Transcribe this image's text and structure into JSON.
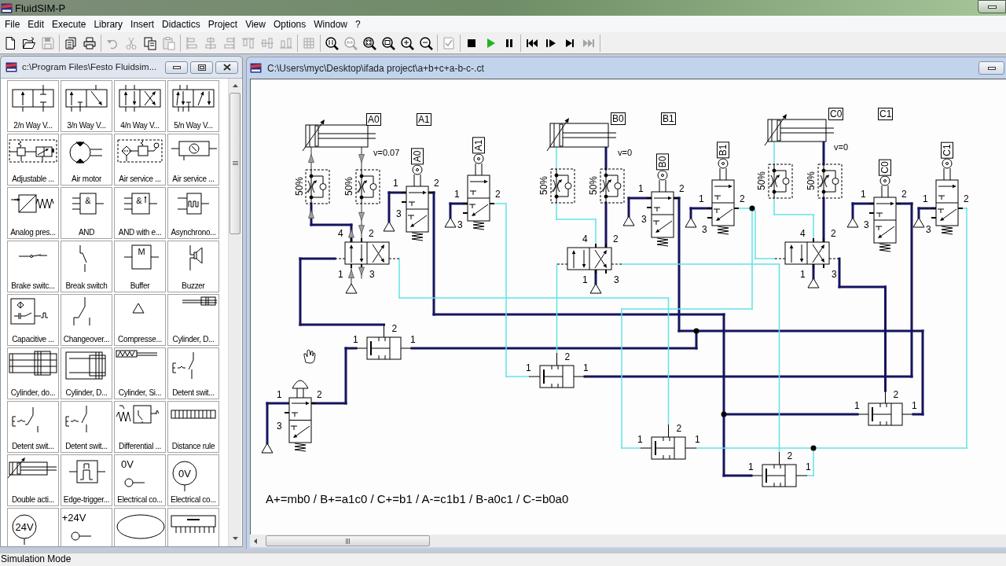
{
  "window": {
    "title": "FluidSIM-P"
  },
  "menu": [
    "File",
    "Edit",
    "Execute",
    "Library",
    "Insert",
    "Didactics",
    "Project",
    "View",
    "Options",
    "Window",
    "?"
  ],
  "toolbar_groups": [
    [
      {
        "kind": "new",
        "disabled": false
      },
      {
        "kind": "open",
        "disabled": false
      },
      {
        "kind": "save",
        "disabled": true
      }
    ],
    [
      {
        "kind": "print_preview",
        "disabled": false
      },
      {
        "kind": "print",
        "disabled": false
      }
    ],
    [
      {
        "kind": "undo",
        "disabled": true
      },
      {
        "kind": "cut",
        "disabled": true
      },
      {
        "kind": "copy",
        "disabled": false
      },
      {
        "kind": "paste",
        "disabled": true
      }
    ],
    [
      {
        "kind": "align_left",
        "disabled": true
      },
      {
        "kind": "align_center",
        "disabled": true
      },
      {
        "kind": "align_right",
        "disabled": true
      },
      {
        "kind": "align_top",
        "disabled": true
      },
      {
        "kind": "align_middle",
        "disabled": true
      },
      {
        "kind": "align_bottom",
        "disabled": true
      }
    ],
    [
      {
        "kind": "grid",
        "disabled": true
      }
    ],
    [
      {
        "kind": "zoom_actual",
        "disabled": false
      },
      {
        "kind": "zoom_previous",
        "disabled": true
      },
      {
        "kind": "zoom_fit",
        "disabled": false
      },
      {
        "kind": "zoom_window",
        "disabled": false
      },
      {
        "kind": "zoom_in",
        "disabled": false
      },
      {
        "kind": "zoom_out",
        "disabled": false
      }
    ],
    [
      {
        "kind": "check",
        "disabled": true
      }
    ],
    [
      {
        "kind": "stop",
        "disabled": false
      },
      {
        "kind": "start",
        "disabled": false
      },
      {
        "kind": "pause",
        "disabled": false
      }
    ],
    [
      {
        "kind": "reset",
        "disabled": false
      },
      {
        "kind": "step",
        "disabled": false
      },
      {
        "kind": "run_to",
        "disabled": false
      },
      {
        "kind": "fast_forward",
        "disabled": true
      }
    ]
  ],
  "library": {
    "title": "c:\\Program Files\\Festo Fluidsim...",
    "items": [
      {
        "kind": "valve_2n",
        "label": "2/n Way V..."
      },
      {
        "kind": "valve_3n",
        "label": "3/n Way V..."
      },
      {
        "kind": "valve_4n",
        "label": "4/n Way V..."
      },
      {
        "kind": "valve_5n",
        "label": "5/n Way V..."
      },
      {
        "kind": "service_adjustable",
        "label": "Adjustable ..."
      },
      {
        "kind": "air_motor",
        "label": "Air motor"
      },
      {
        "kind": "service_unit",
        "label": "Air service ..."
      },
      {
        "kind": "service_simple",
        "label": "Air service ..."
      },
      {
        "kind": "analog_converter",
        "label": "Analog pres..."
      },
      {
        "kind": "and_gate",
        "label": "AND",
        "symbol_text": "&"
      },
      {
        "kind": "and_edge",
        "label": "AND with e...",
        "symbol_text": "&"
      },
      {
        "kind": "async",
        "label": "Asynchrono..."
      },
      {
        "kind": "brake_switch",
        "label": "Brake switc..."
      },
      {
        "kind": "break_switch",
        "label": "Break switch"
      },
      {
        "kind": "buffer",
        "label": "Buffer",
        "symbol_text": "M"
      },
      {
        "kind": "buzzer",
        "label": "Buzzer"
      },
      {
        "kind": "capacitive",
        "label": "Capacitive ..."
      },
      {
        "kind": "changeover",
        "label": "Changeover..."
      },
      {
        "kind": "compressor",
        "label": "Compresse..."
      },
      {
        "kind": "cylinder_thin",
        "label": "Cylinder, D..."
      },
      {
        "kind": "cylinder_double",
        "label": "Cylinder, do..."
      },
      {
        "kind": "cylinder_d2",
        "label": "Cylinder, D..."
      },
      {
        "kind": "cylinder_spring",
        "label": "Cylinder, Si..."
      },
      {
        "kind": "detent_a",
        "label": "Detent swit..."
      },
      {
        "kind": "detent_b",
        "label": "Detent swit..."
      },
      {
        "kind": "detent_c",
        "label": "Detent swit..."
      },
      {
        "kind": "differential",
        "label": "Differential ..."
      },
      {
        "kind": "distance_rule",
        "label": "Distance rule"
      },
      {
        "kind": "double_acting",
        "label": "Double acti..."
      },
      {
        "kind": "edge_trigger",
        "label": "Edge-trigger..."
      },
      {
        "kind": "terminal",
        "label": "Electrical co...",
        "symbol_text": "0V"
      },
      {
        "kind": "ring_terminal",
        "label": "Electrical co...",
        "symbol_text": "0V"
      },
      {
        "kind": "ring_terminal",
        "symbol_text": "24V"
      },
      {
        "kind": "terminal",
        "symbol_text": "+24V"
      },
      {
        "kind": "ellipse"
      },
      {
        "kind": "chip"
      }
    ]
  },
  "diagram": {
    "title": "C:\\Users\\myc\\Desktop\\ifada project\\a+b+c+a-b-c-.ct",
    "cylinders": [
      {
        "sensor_tags": [
          "A0",
          "A1"
        ],
        "speed": "v=0.07",
        "throttle_settings": [
          "50%",
          "50%"
        ]
      },
      {
        "sensor_tags": [
          "B0",
          "B1"
        ],
        "speed": "v=0",
        "throttle_settings": [
          "50%",
          "50%"
        ]
      },
      {
        "sensor_tags": [
          "C0",
          "C1"
        ],
        "speed": "v=0",
        "throttle_settings": [
          "50%",
          "50%"
        ]
      }
    ],
    "directional_valves": [
      {
        "switched": true,
        "ports": [
          "4",
          "2",
          "1",
          "3"
        ]
      },
      {
        "switched": false,
        "ports": [
          "4",
          "2",
          "1",
          "3"
        ]
      },
      {
        "switched": false,
        "ports": [
          "4",
          "2",
          "1",
          "3"
        ]
      }
    ],
    "limit_valves": [
      {
        "label": "A0",
        "actuated": true,
        "ports": [
          "1",
          "2",
          "3"
        ]
      },
      {
        "label": "A1",
        "actuated": false,
        "ports": [
          "1",
          "2",
          "3"
        ]
      },
      {
        "label": "B0",
        "actuated": true,
        "ports": [
          "1",
          "2",
          "3"
        ]
      },
      {
        "label": "B1",
        "actuated": false,
        "ports": [
          "1",
          "2",
          "3"
        ]
      },
      {
        "label": "C0",
        "actuated": true,
        "ports": [
          "1",
          "2",
          "3"
        ]
      },
      {
        "label": "C1",
        "actuated": false,
        "ports": [
          "1",
          "2",
          "3"
        ]
      }
    ],
    "start_valve": {
      "pressed": true,
      "ports": [
        "1",
        "2",
        "3"
      ]
    },
    "and_valves": [
      {
        "ports": [
          "1",
          "1",
          "2"
        ]
      },
      {
        "ports": [
          "1",
          "1",
          "2"
        ]
      },
      {
        "ports": [
          "1",
          "1",
          "2"
        ]
      },
      {
        "ports": [
          "1",
          "1",
          "2"
        ]
      },
      {
        "ports": [
          "1",
          "1",
          "2"
        ]
      }
    ],
    "pipe_segments": [
      {
        "pressurized": true,
        "flowing": false
      },
      {
        "pressurized": true,
        "flowing": false
      },
      {
        "pressurized": true,
        "flowing": false
      },
      {
        "pressurized": true,
        "flowing": false
      },
      {
        "pressurized": true,
        "flowing": false
      },
      {
        "pressurized": true,
        "flowing": false
      },
      {
        "pressurized": true,
        "flowing": false
      },
      {
        "pressurized": true,
        "flowing": false
      },
      {
        "pressurized": true,
        "flowing": false
      },
      {
        "pressurized": true,
        "flowing": false
      },
      {
        "pressurized": true,
        "flowing": false
      },
      {
        "pressurized": true,
        "flowing": false
      },
      {
        "pressurized": true,
        "flowing": false
      },
      {
        "pressurized": true,
        "flowing": false
      },
      {
        "pressurized": true,
        "flowing": false
      },
      {
        "pressurized": true,
        "flowing": false
      },
      {
        "pressurized": true,
        "flowing": false
      },
      {
        "pressurized": true,
        "flowing": false
      },
      {
        "pressurized": true,
        "flowing": false
      },
      {
        "pressurized": true,
        "flowing": false
      },
      {
        "pressurized": true,
        "flowing": false
      },
      {
        "pressurized": true,
        "flowing": false
      },
      {
        "pressurized": true,
        "flowing": false
      },
      {
        "pressurized": true,
        "flowing": false
      },
      {
        "pressurized": true,
        "flowing": false
      },
      {
        "pressurized": true,
        "flowing": false
      },
      {
        "pressurized": true,
        "flowing": false
      },
      {
        "pressurized": true,
        "flowing": false
      },
      {
        "pressurized": true,
        "flowing": false
      },
      {
        "pressurized": true,
        "flowing": false
      },
      {
        "pressurized": true,
        "flowing": false
      },
      {
        "pressurized": true,
        "flowing": false
      },
      {
        "pressurized": true,
        "flowing": false
      },
      {
        "pressurized": true,
        "flowing": false
      },
      {
        "pressurized": true,
        "flowing": false
      },
      {
        "pressurized": true,
        "flowing": false
      },
      {
        "pressurized": true,
        "flowing": true
      },
      {
        "pressurized": true,
        "flowing": false
      },
      {
        "pressurized": true,
        "flowing": true
      },
      {
        "pressurized": true,
        "flowing": false
      },
      {
        "pressurized": true,
        "flowing": false
      },
      {
        "pressurized": true,
        "flowing": false
      },
      {
        "pressurized": true,
        "flowing": false
      },
      {
        "pressurized": true,
        "flowing": false
      },
      {
        "pressurized": true,
        "flowing": false
      },
      {
        "pressurized": true,
        "flowing": false
      },
      {
        "pressurized": true,
        "flowing": false
      },
      {
        "pressurized": true,
        "flowing": false
      },
      {
        "pressurized": false,
        "flowing": false
      },
      {
        "pressurized": false,
        "flowing": false
      },
      {
        "pressurized": false,
        "flowing": false
      },
      {
        "pressurized": false,
        "flowing": false
      },
      {
        "pressurized": false,
        "flowing": false
      },
      {
        "pressurized": false,
        "flowing": false
      },
      {
        "pressurized": false,
        "flowing": false
      },
      {
        "pressurized": false,
        "flowing": false
      },
      {
        "pressurized": false,
        "flowing": false
      },
      {
        "pressurized": false,
        "flowing": false
      },
      {
        "pressurized": false,
        "flowing": false
      },
      {
        "pressurized": false,
        "flowing": false
      },
      {
        "pressurized": false,
        "flowing": false
      },
      {
        "pressurized": false,
        "flowing": false
      },
      {
        "pressurized": false,
        "flowing": false
      },
      {
        "pressurized": false,
        "flowing": false
      },
      {
        "pressurized": false,
        "flowing": false
      },
      {
        "pressurized": false,
        "flowing": false
      },
      {
        "pressurized": false,
        "flowing": false
      },
      {
        "pressurized": false,
        "flowing": false
      },
      {
        "pressurized": false,
        "flowing": false
      },
      {
        "pressurized": false,
        "flowing": false
      },
      {
        "pressurized": false,
        "flowing": false
      },
      {
        "pressurized": false,
        "flowing": false
      },
      {
        "pressurized": false,
        "flowing": false
      },
      {
        "pressurized": false,
        "flowing": false
      },
      {
        "pressurized": false,
        "flowing": false
      },
      {
        "pressurized": false,
        "flowing": false
      },
      {
        "pressurized": false,
        "flowing": false
      },
      {
        "pressurized": false,
        "flowing": true
      },
      {
        "pressurized": false,
        "flowing": true
      },
      {
        "pressurized": false,
        "flowing": true
      },
      {
        "pressurized": false,
        "flowing": true
      },
      {
        "pressurized": false,
        "flowing": true
      }
    ],
    "formula": "A+=mb0 / B+=a1c0 / C+=b1 / A-=c1b1 / B-a0c1 / C-=b0a0"
  },
  "status_bar": "Simulation Mode"
}
